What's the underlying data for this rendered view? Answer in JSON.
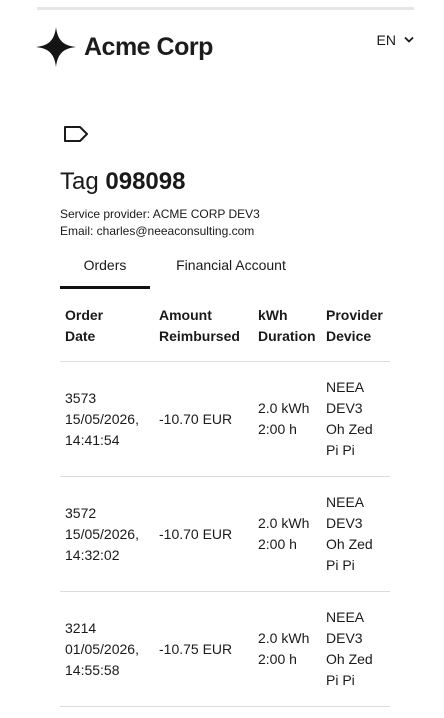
{
  "header": {
    "brand": "Acme Corp",
    "language": "EN"
  },
  "page": {
    "title_prefix": "Tag",
    "tag_number": "098098",
    "service_provider": "Service provider: ACME CORP DEV3",
    "email": "Email: charles@neeaconsulting.com"
  },
  "tabs": [
    {
      "label": "Orders",
      "active": true
    },
    {
      "label": "Financial Account",
      "active": false
    }
  ],
  "table": {
    "headers": {
      "order": [
        "Order",
        "Date"
      ],
      "amount": [
        "Amount",
        "Reimbursed"
      ],
      "kwh": [
        "kWh",
        "Duration"
      ],
      "provider": [
        "Provider",
        "Device"
      ]
    },
    "rows": [
      {
        "order_id": "3573",
        "date": "15/05/2026,",
        "time": "14:41:54",
        "amount": "-10.70 EUR",
        "kwh": "2.0 kWh",
        "duration": "2:00 h",
        "provider_lines": [
          "NEEA",
          "DEV3",
          "Oh Zed",
          "Pi Pi"
        ]
      },
      {
        "order_id": "3572",
        "date": "15/05/2026,",
        "time": "14:32:02",
        "amount": "-10.70 EUR",
        "kwh": "2.0 kWh",
        "duration": "2:00 h",
        "provider_lines": [
          "NEEA",
          "DEV3",
          "Oh Zed",
          "Pi Pi"
        ]
      },
      {
        "order_id": "3214",
        "date": "01/05/2026,",
        "time": "14:55:58",
        "amount": "-10.75 EUR",
        "kwh": "2.0 kWh",
        "duration": "2:00 h",
        "provider_lines": [
          "NEEA",
          "DEV3",
          "Oh Zed",
          "Pi Pi"
        ]
      }
    ]
  }
}
